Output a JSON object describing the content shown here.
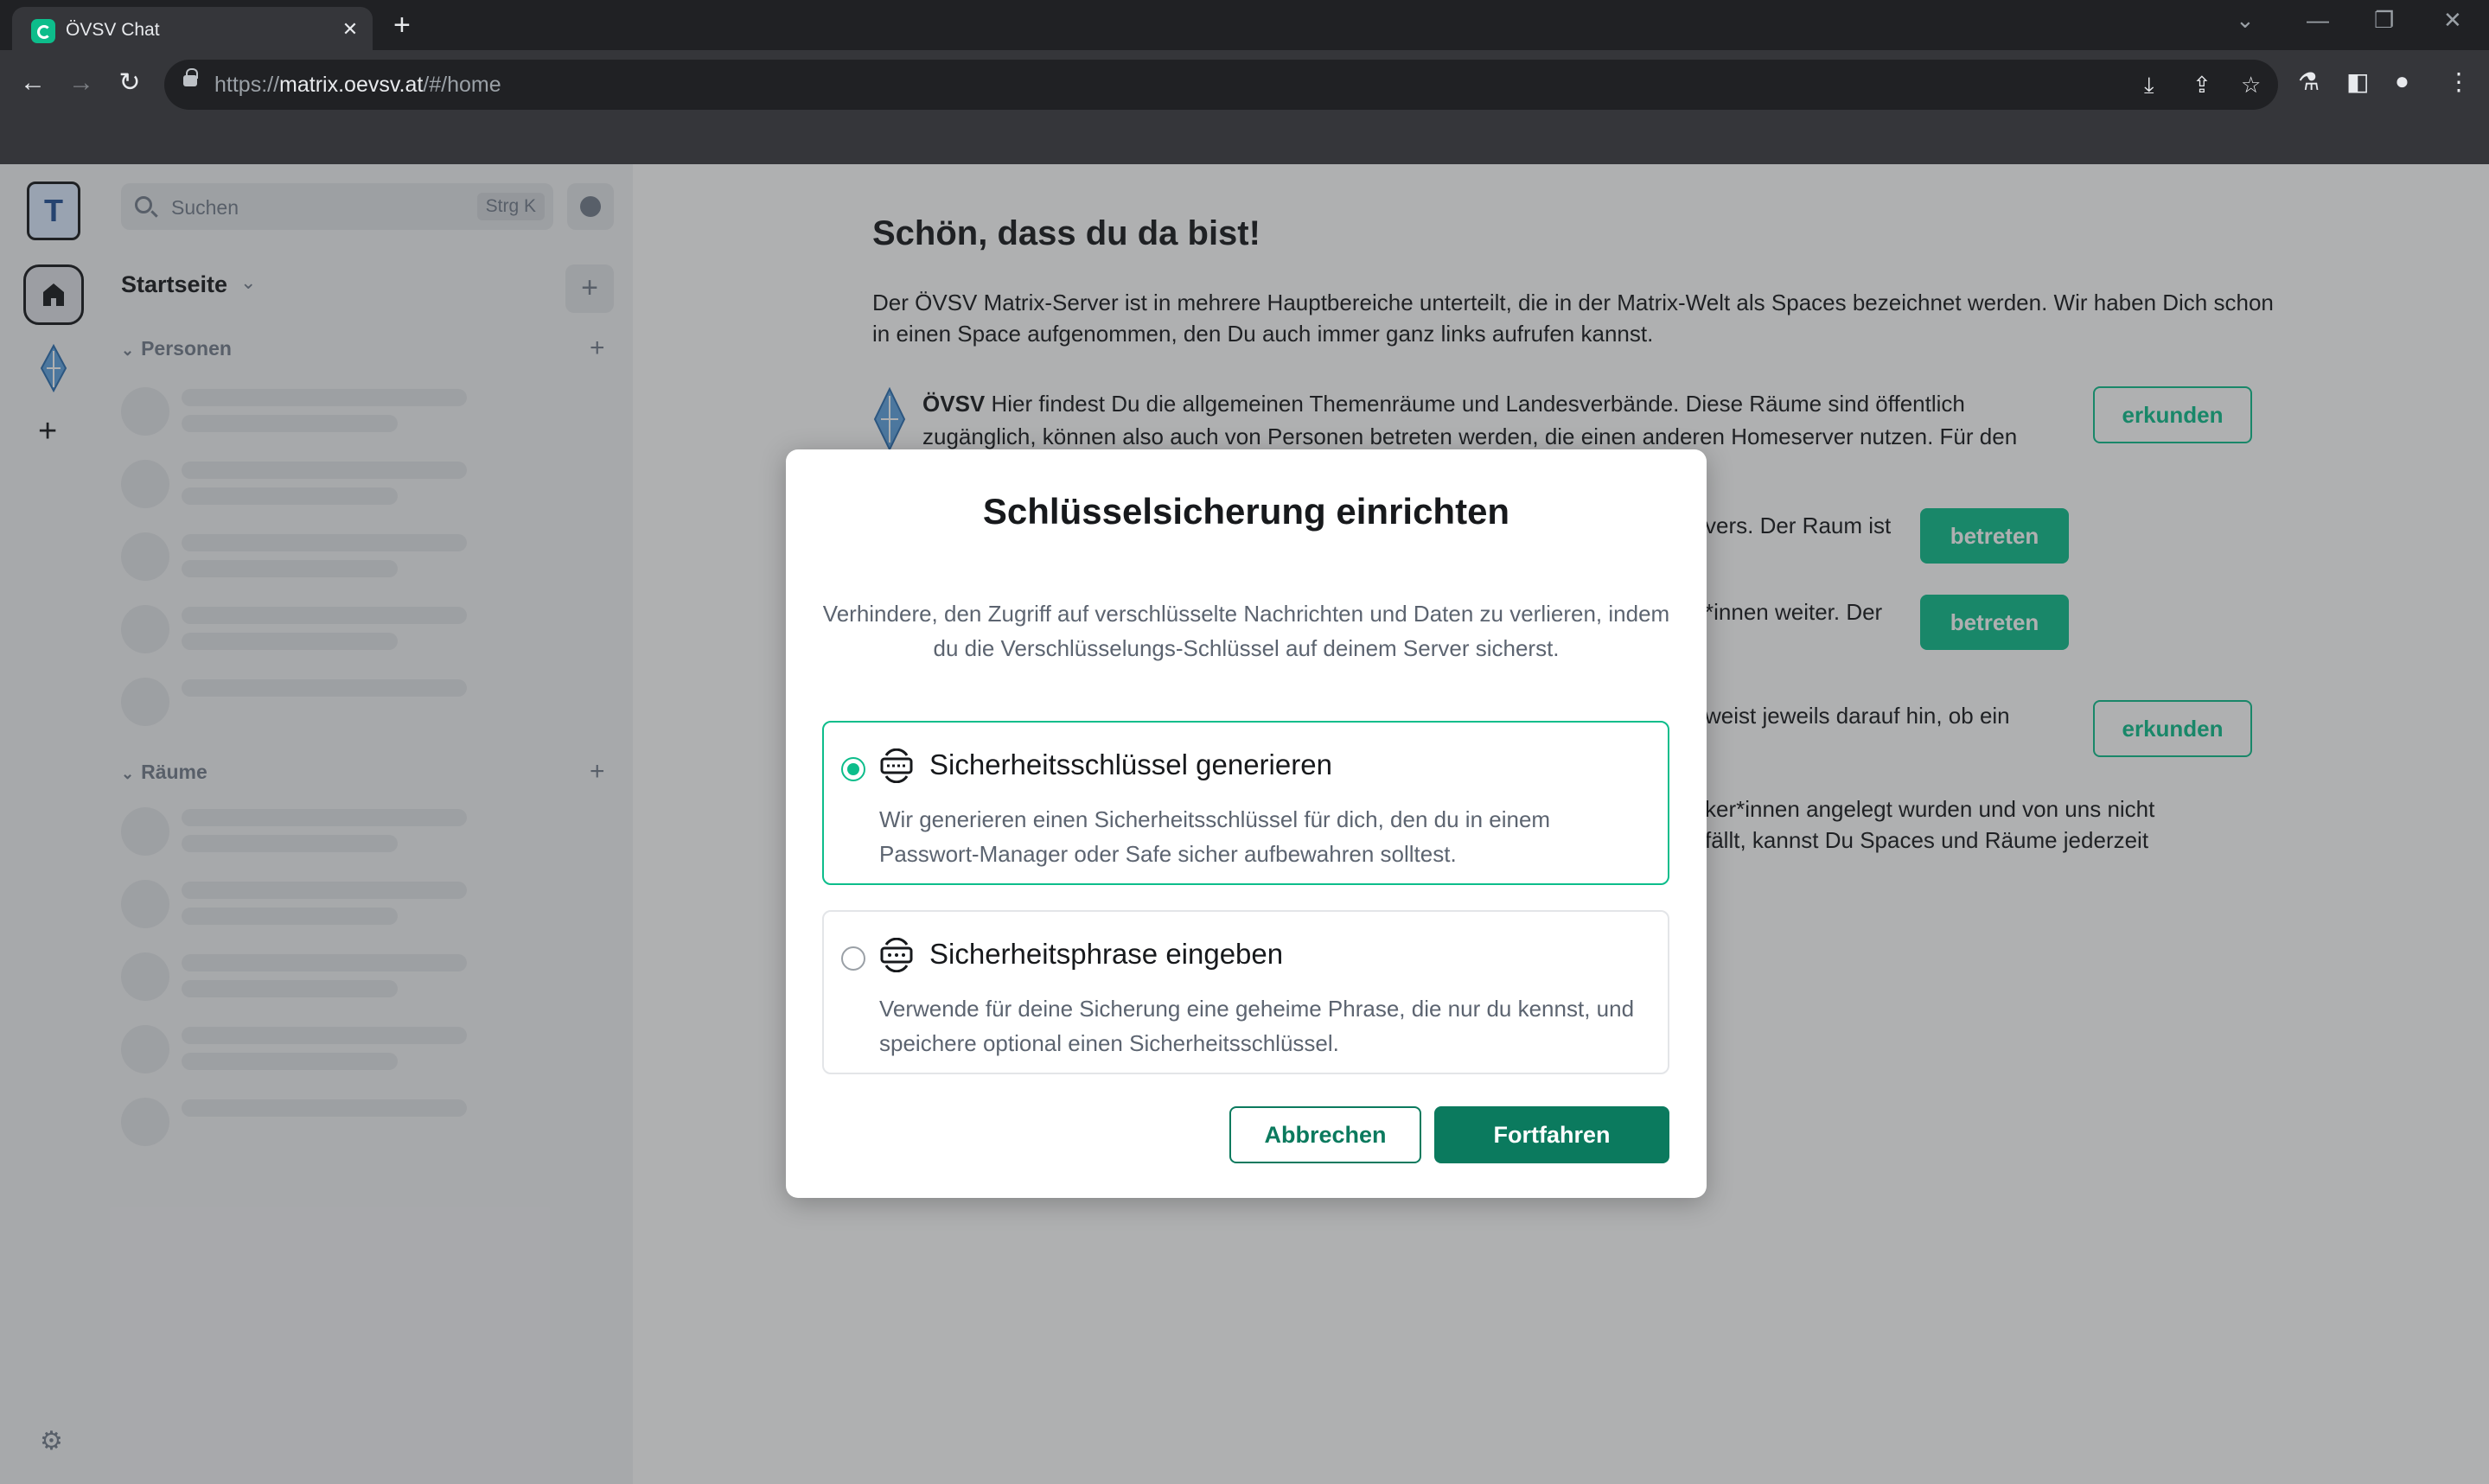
{
  "browser": {
    "tab_title": "ÖVSV Chat",
    "url_prefix": "https://",
    "url_host": "matrix.oevsv.at",
    "url_path": "/#/home",
    "accent": "#0dbd8b"
  },
  "sidebar": {
    "space_initial": "T",
    "search_placeholder": "Suchen",
    "search_shortcut": "Strg K",
    "home_title": "Startseite",
    "people_label": "Personen",
    "rooms_label": "Räume"
  },
  "main": {
    "title": "Schön, dass du da bist!",
    "intro": "Der ÖVSV Matrix-Server ist in mehrere Hauptbereiche unterteilt, die in der Matrix-Welt als Spaces bezeichnet werden. Wir haben Dich schon in einen Space aufgenommen, den Du auch immer ganz links aufrufen kannst.",
    "oevsv_name": "ÖVSV",
    "oevsv_text": "Hier findest Du die allgemeinen Themenräume und Landesverbände. Diese Räume sind öffentlich zugänglich, können also auch von Personen betreten werden, die einen anderen Homeserver nutzen. Für den",
    "frag_1": "vers. Der Raum ist",
    "frag_2": "*innen weiter. Der",
    "frag_3": "weist jeweils darauf hin, ob ein",
    "frag_4a": "ker*innen angelegt wurden und von uns nicht",
    "frag_4b": "fällt, kannst Du Spaces und Räume jederzeit",
    "explore_label": "erkunden",
    "join_label": "betreten"
  },
  "dialog": {
    "title": "Schlüsselsicherung einrichten",
    "description": "Verhindere, den Zugriff auf verschlüsselte Nachrichten und Daten zu verlieren, indem du die Verschlüsselungs-Schlüssel auf deinem Server sicherst.",
    "options": [
      {
        "title": "Sicherheitsschlüssel generieren",
        "description": "Wir generieren einen Sicherheitsschlüssel für dich, den du in einem Passwort-Manager oder Safe sicher aufbewahren solltest.",
        "selected": true
      },
      {
        "title": "Sicherheitsphrase eingeben",
        "description": "Verwende für deine Sicherung eine geheime Phrase, die nur du kennst, und speichere optional einen Sicherheitsschlüssel.",
        "selected": false
      }
    ],
    "cancel_label": "Abbrechen",
    "continue_label": "Fortfahren",
    "primary_color": "#0b7a5e"
  }
}
